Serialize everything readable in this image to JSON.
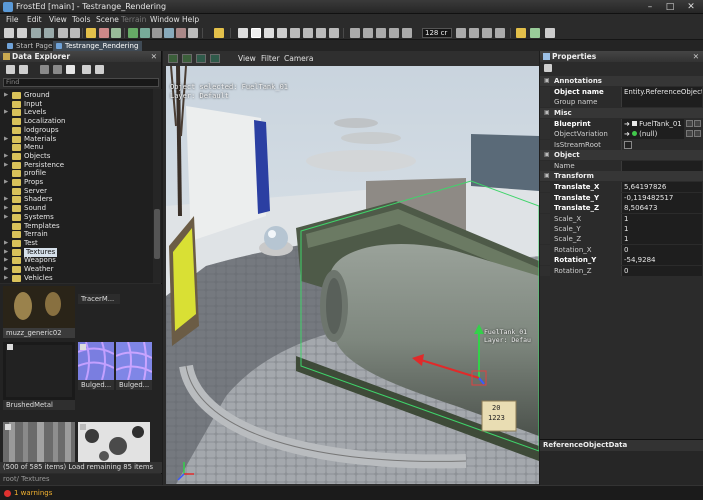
{
  "window": {
    "title": "FrostEd [main] - Testrange_Rendering",
    "min_glyph": "–",
    "max_glyph": "□",
    "close_glyph": "✕"
  },
  "menu": {
    "items": [
      "File",
      "Edit",
      "View",
      "Tools",
      "Scene",
      "Terrain",
      "Window",
      "Help"
    ],
    "disabled_index": 5
  },
  "toolbar": {
    "zoom_value": "128 cr"
  },
  "doc_tabs": [
    {
      "label": "Start Page",
      "active": false
    },
    {
      "label": "Testrange_Rendering",
      "active": true
    }
  ],
  "data_explorer": {
    "title": "Data Explorer",
    "close_glyph": "✕",
    "search_placeholder": "Find",
    "tree": [
      {
        "label": "Ground",
        "expandable": true
      },
      {
        "label": "Input",
        "expandable": false
      },
      {
        "label": "Levels",
        "expandable": true
      },
      {
        "label": "Localization",
        "expandable": false
      },
      {
        "label": "lodgroups",
        "expandable": false
      },
      {
        "label": "Materials",
        "expandable": true
      },
      {
        "label": "Menu",
        "expandable": false
      },
      {
        "label": "Objects",
        "expandable": true
      },
      {
        "label": "Persistence",
        "expandable": true
      },
      {
        "label": "profile",
        "expandable": false
      },
      {
        "label": "Props",
        "expandable": true
      },
      {
        "label": "Server",
        "expandable": false
      },
      {
        "label": "Shaders",
        "expandable": true
      },
      {
        "label": "Sound",
        "expandable": true
      },
      {
        "label": "Systems",
        "expandable": true
      },
      {
        "label": "Templates",
        "expandable": false
      },
      {
        "label": "Terrain",
        "expandable": false
      },
      {
        "label": "Test",
        "expandable": true
      },
      {
        "label": "Textures",
        "expandable": true,
        "selected": true
      },
      {
        "label": "Weapons",
        "expandable": true
      },
      {
        "label": "Weather",
        "expandable": true
      },
      {
        "label": "Vehicles",
        "expandable": true
      }
    ],
    "thumbnails": [
      {
        "caption": "muzz_generic02"
      },
      {
        "caption": "TracerM..."
      },
      {
        "caption": "BrushedMetal"
      },
      {
        "caption": "Bulged..."
      },
      {
        "caption": "Bulged..."
      }
    ],
    "status": "(500 of 585 items) Load remaining 85 items",
    "path": "root/ Textures"
  },
  "viewport": {
    "menus": [
      "View",
      "Filter",
      "Camera"
    ],
    "overlay_line1": "Object selected: FuelTank_01",
    "overlay_line2": "Layer: Default",
    "label_line1": "FuelTank_01",
    "label_line2": "Layer: Defau",
    "sign_text": "20",
    "sign_text2": "1223"
  },
  "properties": {
    "title": "Properties",
    "close_glyph": "✕",
    "categories": [
      {
        "name": "Annotations",
        "rows": [
          {
            "key": "Object name",
            "bold": true,
            "value": "Entity.ReferenceObjectData"
          },
          {
            "key": "Group name",
            "bold": false,
            "value": ""
          }
        ]
      },
      {
        "name": "Misc",
        "rows": [
          {
            "key": "Blueprint",
            "bold": true,
            "value": "FuelTank_01 (P...",
            "kind": "blueprint"
          },
          {
            "key": "ObjectVariation",
            "bold": false,
            "value": "(null)",
            "kind": "variation"
          },
          {
            "key": "IsStreamRoot",
            "bold": false,
            "value": "",
            "kind": "check"
          }
        ]
      },
      {
        "name": "Object",
        "rows": [
          {
            "key": "Name",
            "bold": false,
            "value": ""
          }
        ]
      },
      {
        "name": "Transform",
        "rows": [
          {
            "key": "Translate_X",
            "bold": true,
            "value": "5,64197826"
          },
          {
            "key": "Translate_Y",
            "bold": true,
            "value": "-0,119482517"
          },
          {
            "key": "Translate_Z",
            "bold": true,
            "value": "8,506473"
          },
          {
            "key": "Scale_X",
            "bold": false,
            "value": "1"
          },
          {
            "key": "Scale_Y",
            "bold": false,
            "value": "1"
          },
          {
            "key": "Scale_Z",
            "bold": false,
            "value": "1"
          },
          {
            "key": "Rotation_X",
            "bold": false,
            "value": "0"
          },
          {
            "key": "Rotation_Y",
            "bold": true,
            "value": "-54,9284"
          },
          {
            "key": "Rotation_Z",
            "bold": false,
            "value": "0"
          }
        ]
      }
    ],
    "description_title": "ReferenceObjectData"
  },
  "statusbar": {
    "warnings": "1 warnings"
  },
  "colors": {
    "accent": "#6fa2d8",
    "folder": "#d9c25a",
    "warning": "#f0b030"
  }
}
